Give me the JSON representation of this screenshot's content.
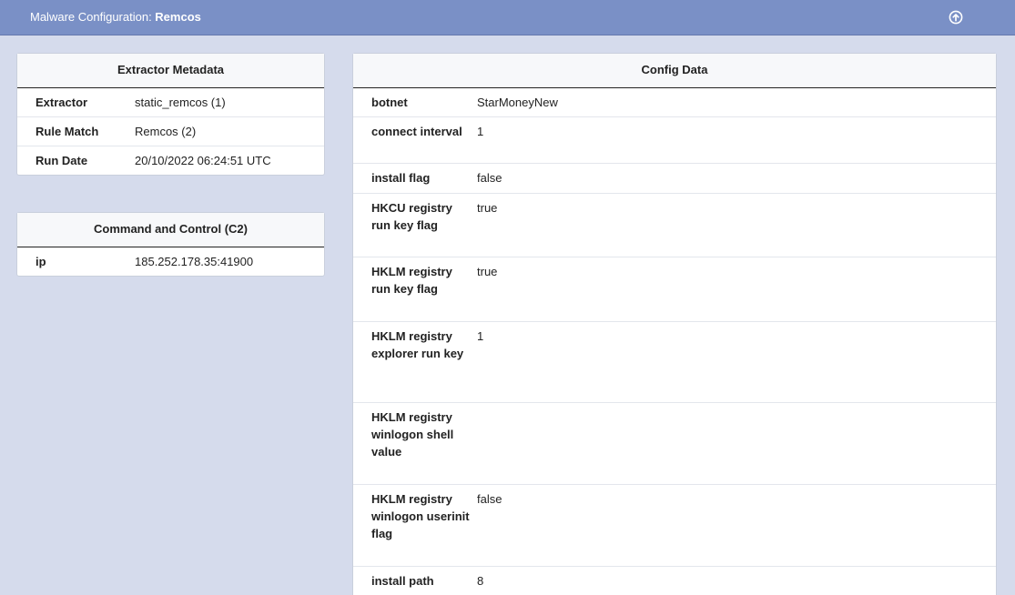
{
  "header": {
    "title_prefix": "Malware Configuration: ",
    "title_name": "Remcos"
  },
  "extractor_metadata": {
    "title": "Extractor Metadata",
    "rows": [
      {
        "key": "Extractor",
        "value": "static_remcos (1)"
      },
      {
        "key": "Rule Match",
        "value": "Remcos (2)"
      },
      {
        "key": "Run Date",
        "value": "20/10/2022 06:24:51 UTC"
      }
    ]
  },
  "c2": {
    "title": "Command and Control (C2)",
    "rows": [
      {
        "key": "ip",
        "value": "185.252.178.35:41900"
      }
    ]
  },
  "config": {
    "title": "Config Data",
    "rows": [
      {
        "key": "botnet",
        "value": "StarMoneyNew"
      },
      {
        "key": "connect interval",
        "value": "1"
      },
      {
        "key": "install flag",
        "value": "false"
      },
      {
        "key": "HKCU registry run key flag",
        "value": "true"
      },
      {
        "key": "HKLM registry run key flag",
        "value": "true"
      },
      {
        "key": "HKLM registry explorer run key",
        "value": "1"
      },
      {
        "key": "HKLM registry winlogon shell value",
        "value": ""
      },
      {
        "key": "HKLM registry winlogon userinit flag",
        "value": "false"
      },
      {
        "key": "install path",
        "value": "8"
      }
    ]
  }
}
